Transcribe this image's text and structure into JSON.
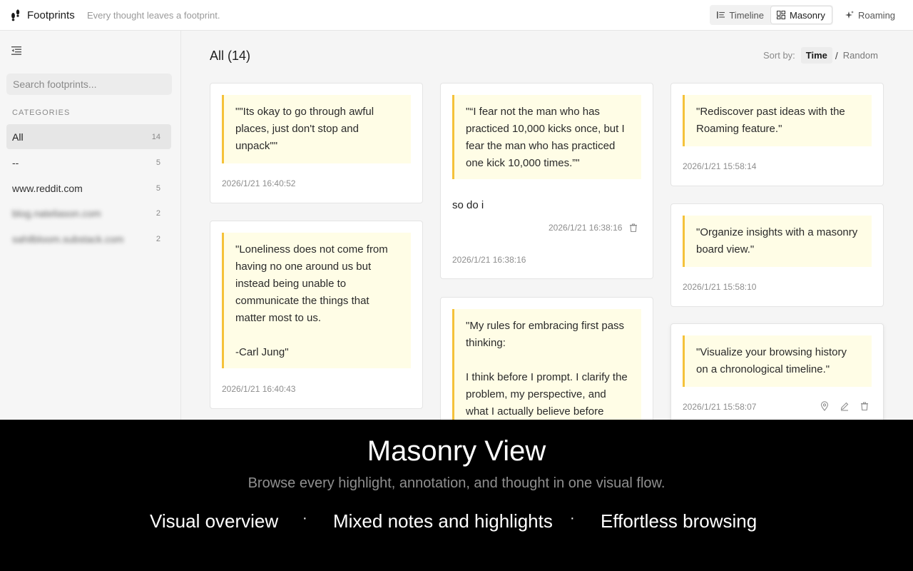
{
  "app": {
    "name": "Footprints",
    "tagline": "Every thought leaves a footprint."
  },
  "views": {
    "timeline": "Timeline",
    "masonry": "Masonry",
    "roaming": "Roaming",
    "active": "Masonry"
  },
  "sidebar": {
    "search_placeholder": "Search footprints...",
    "categories_label": "CATEGORIES",
    "categories": [
      {
        "label": "All",
        "count": "14"
      },
      {
        "label": "--",
        "count": "5"
      },
      {
        "label": "www.reddit.com",
        "count": "5"
      },
      {
        "label": "blog.nateliason.com",
        "count": "2"
      },
      {
        "label": "sahilbloom.substack.com",
        "count": "2"
      }
    ]
  },
  "main": {
    "title": "All (14)",
    "sort_label": "Sort by:",
    "sort_time": "Time",
    "sort_sep": "/",
    "sort_random": "Random"
  },
  "cards": [
    {
      "quote": "\"\"Its okay to go through awful places, just don't stop and unpack\"\"",
      "timestamp": "2026/1/21 16:40:52"
    },
    {
      "quote": "\"Loneliness does not come from having no one around us but instead being unable to communicate the things that matter most to us.\n\n-Carl Jung\"",
      "timestamp": "2026/1/21 16:40:43"
    },
    {
      "quote": "\"“I fear not the man who has practiced 10,000 kicks once, but I fear the man who has practiced one kick 10,000 times.”\"",
      "note": "so do i",
      "note_timestamp": "2026/1/21 16:38:16",
      "timestamp": "2026/1/21 16:38:16"
    },
    {
      "quote": "\"My rules for embracing first pass thinking:\n\nI think before I prompt. I clarify the problem, my perspective, and what I actually believe before"
    },
    {
      "quote": "\"Rediscover past ideas with the Roaming feature.\"",
      "timestamp": "2026/1/21 15:58:14"
    },
    {
      "quote": "\"Organize insights with a masonry board view.\"",
      "timestamp": "2026/1/21 15:58:10"
    },
    {
      "quote": "\"Visualize your browsing history on a chronological timeline.\"",
      "timestamp": "2026/1/21 15:58:07"
    }
  ],
  "overlay": {
    "title": "Masonry View",
    "subtitle": "Browse every highlight, annotation, and thought in one visual flow.",
    "features": [
      "Visual overview",
      "Mixed notes and highlights",
      "Effortless browsing"
    ],
    "separator": "·"
  },
  "colors": {
    "accent": "#f5c23a",
    "quote_bg": "#fffde6"
  }
}
